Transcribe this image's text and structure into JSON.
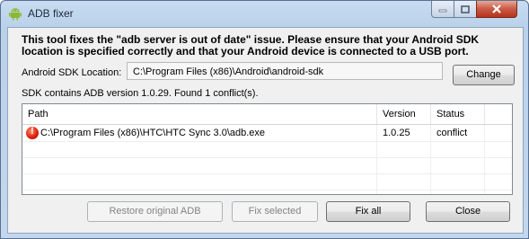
{
  "window": {
    "title": "ADB fixer"
  },
  "info_text": "This tool fixes the \"adb server is out of date\" issue. Please ensure that your Android SDK location is specified correctly and that your Android device is connected to a USB port.",
  "sdk": {
    "label": "Android SDK Location:",
    "value": "C:\\Program Files (x86)\\Android\\android-sdk",
    "change_label": "Change"
  },
  "status_text": "SDK contains ADB version 1.0.29. Found 1 conflict(s).",
  "table": {
    "columns": [
      "Path",
      "Version",
      "Status"
    ],
    "rows": [
      {
        "path": "C:\\Program Files (x86)\\HTC\\HTC Sync 3.0\\adb.exe",
        "version": "1.0.25",
        "status": "conflict"
      }
    ]
  },
  "buttons": {
    "restore": "Restore original ADB",
    "fix_selected": "Fix selected",
    "fix_all": "Fix all",
    "close": "Close"
  }
}
